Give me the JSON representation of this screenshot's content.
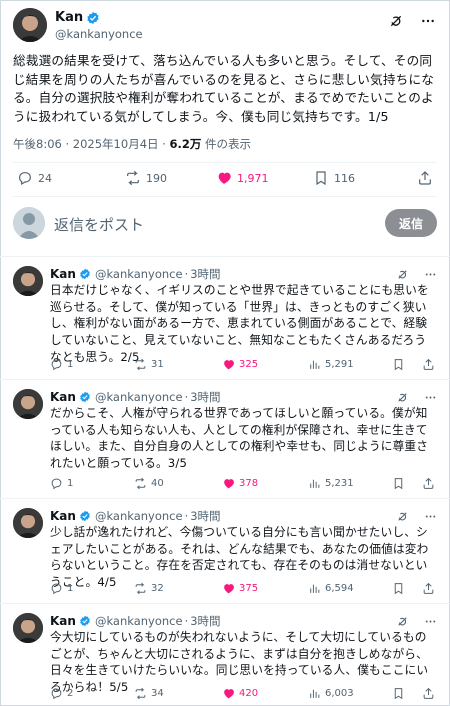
{
  "main_tweet": {
    "display_name": "Kan",
    "handle": "@kankanyonce",
    "text": "総裁選の結果を受けて、落ち込んでいる人も多いと思う。そして、その同じ結果を周りの人たちが喜んでいるのを見ると、さらに悲しい気持ちになる。自分の選択肢や権利が奪われていることが、まるでめでたいことのように扱われている気がしてしまう。今、僕も同じ気持ちです。1/5",
    "timestamp": "午後8:06 · 2025年10月4日 · ",
    "views": "6.2万",
    "views_suffix": " 件の表示",
    "stats": {
      "replies": "24",
      "reposts": "190",
      "likes": "1,971",
      "bookmarks": "116"
    }
  },
  "reply_box": {
    "placeholder": "返信をポスト",
    "button_label": "返信"
  },
  "thread": [
    {
      "name": "Kan",
      "handle": "@kankanyonce",
      "time": "3時間",
      "text": "日本だけじゃなく、イギリスのことや世界で起きていることにも思いを巡らせる。そして、僕が知っている「世界」は、きっとものすごく狭いし、権利がない面があるー方で、恵まれている側面があることで、経験していないこと、見えていないこと、無知なこともたくさんあるだろうなとも思う。2/5",
      "replies": "1",
      "reposts": "31",
      "likes": "325",
      "views": "5,291"
    },
    {
      "name": "Kan",
      "handle": "@kankanyonce",
      "time": "3時間",
      "text": "だからこそ、人権が守られる世界であってほしいと願っている。僕が知っている人も知らない人も、人としての権利が保障され、幸せに生きてほしい。また、自分自身の人としての権利や幸せも、同じように尊重されたいと願っている。3/5",
      "replies": "1",
      "reposts": "40",
      "likes": "378",
      "views": "5,231"
    },
    {
      "name": "Kan",
      "handle": "@kankanyonce",
      "time": "3時間",
      "text": "少し話が逸れたけれど、今傷ついている自分にも言い聞かせたいし、シェアしたいことがある。それは、どんな結果でも、あなたの価値は変わらないということ。存在を否定されても、存在そのものは消せないということ。4/5",
      "replies": "1",
      "reposts": "32",
      "likes": "375",
      "views": "6,594"
    },
    {
      "name": "Kan",
      "handle": "@kankanyonce",
      "time": "3時間",
      "text": "今大切にしているものが失われないように、そして大切にしているものごとが、ちゃんと大切にされるように、まずは自分を抱きしめながら、日々を生きていけたらいいな。同じ思いを持っている人、僕もここにいるからね！5/5",
      "replies": "2",
      "reposts": "34",
      "likes": "420",
      "views": "6,003"
    }
  ],
  "colors": {
    "like": "#f91880",
    "verified": "#1d9bf0",
    "muted": "#536471"
  }
}
